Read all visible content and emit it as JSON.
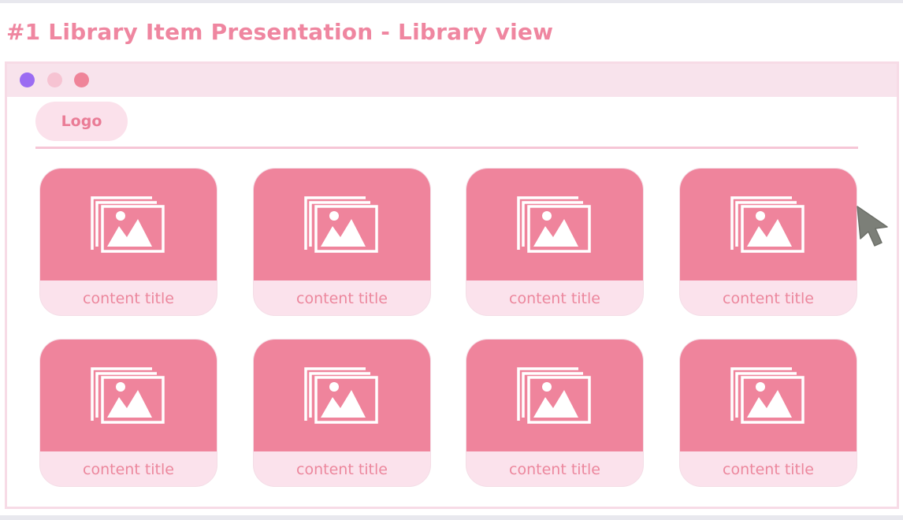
{
  "page": {
    "heading": "#1 Library Item Presentation - Library view"
  },
  "window": {
    "controls": [
      "close",
      "minimize",
      "maximize"
    ],
    "colors": {
      "close": "#9b6cf2",
      "minimize": "#f6c3d2",
      "maximize": "#ef8499"
    }
  },
  "header": {
    "logo_label": "Logo"
  },
  "library": {
    "items": [
      {
        "title": "content title",
        "icon": "image-gallery-icon"
      },
      {
        "title": "content title",
        "icon": "image-gallery-icon"
      },
      {
        "title": "content title",
        "icon": "image-gallery-icon"
      },
      {
        "title": "content title",
        "icon": "image-gallery-icon"
      },
      {
        "title": "content title",
        "icon": "image-gallery-icon"
      },
      {
        "title": "content title",
        "icon": "image-gallery-icon"
      },
      {
        "title": "content title",
        "icon": "image-gallery-icon"
      },
      {
        "title": "content title",
        "icon": "image-gallery-icon"
      }
    ]
  },
  "theme": {
    "accent": "#ef849c",
    "card_footer": "#fbe2ec",
    "heading_color": "#ef86a0",
    "cursor_color": "#7c7f78"
  }
}
